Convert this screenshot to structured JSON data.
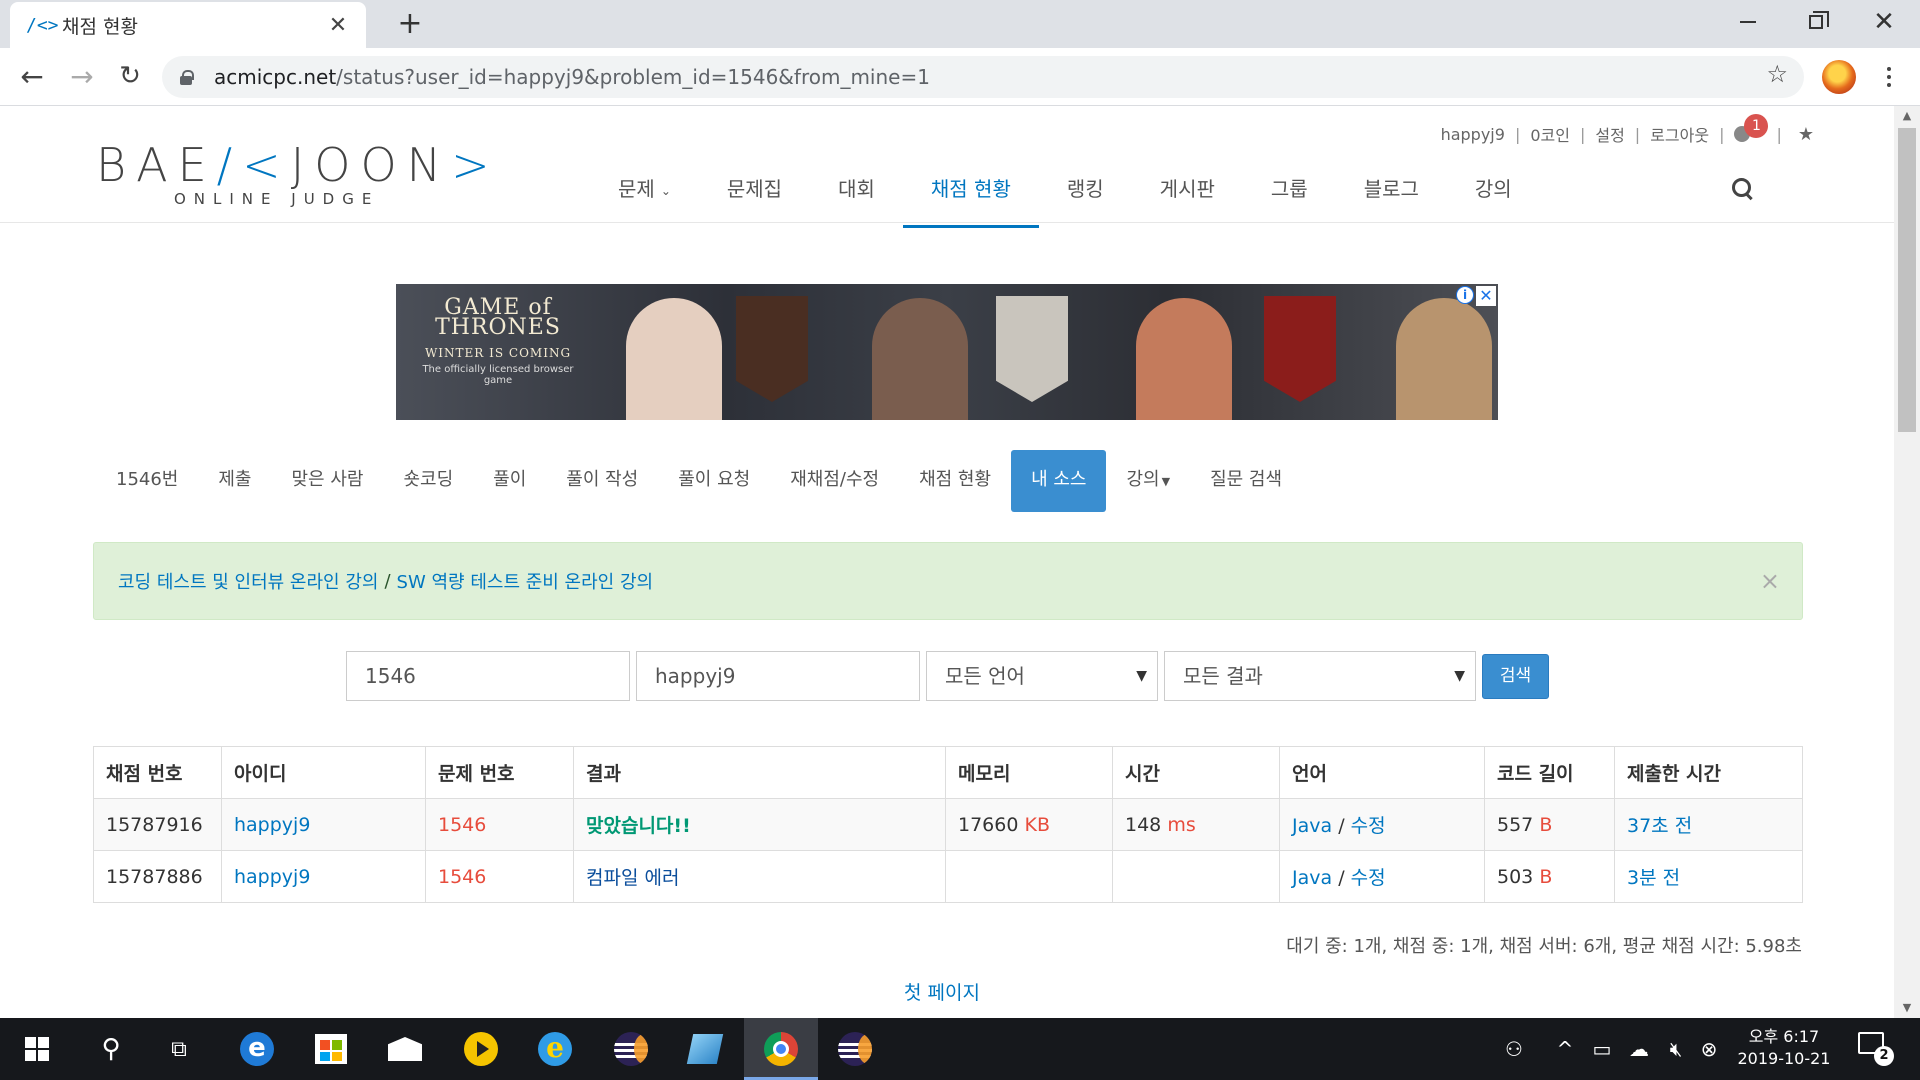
{
  "browser": {
    "tab_favicon": "/<>",
    "tab_title": "채점 현황",
    "tab_close": "✕",
    "new_tab": "+",
    "url_host": "acmicpc.net",
    "url_path": "/status?user_id=happyj9&problem_id=1546&from_mine=1"
  },
  "site": {
    "logo_left": "BAE",
    "logo_accent": "/<",
    "logo_right": "JOON",
    "logo_end": ">",
    "logo_sub": "ONLINE JUDGE",
    "toplinks": {
      "user": "happyj9",
      "coins": "0코인",
      "settings": "설정",
      "logout": "로그아웃",
      "notification_count": "1",
      "sep": "|",
      "favstar": "★"
    },
    "nav": [
      "문제",
      "문제집",
      "대회",
      "채점 현황",
      "랭킹",
      "게시판",
      "그룹",
      "블로그",
      "강의"
    ],
    "nav_active": "채점 현황"
  },
  "ad": {
    "title_1": "GAME of",
    "title_2": "THRONES",
    "subtitle": "WINTER IS COMING",
    "tagline": "The officially licensed browser game",
    "info": "i",
    "close": "✕"
  },
  "subnav": [
    "1546번",
    "제출",
    "맞은 사람",
    "숏코딩",
    "풀이",
    "풀이 작성",
    "풀이 요청",
    "재채점/수정",
    "채점 현황",
    "내 소스",
    "강의",
    "질문 검색"
  ],
  "alert": {
    "link1": "코딩 테스트 및 인터뷰 온라인 강의",
    "slash": "/",
    "link2": "SW 역량 테스트 준비 온라인 강의",
    "close": "×"
  },
  "search": {
    "problem_id": "1546",
    "user_id": "happyj9",
    "language": "모든 언어",
    "result": "모든 결과",
    "button": "검색",
    "dropdown_glyph": "▼"
  },
  "table": {
    "headers": [
      "채점 번호",
      "아이디",
      "문제 번호",
      "결과",
      "메모리",
      "시간",
      "언어",
      "코드 길이",
      "제출한 시간"
    ],
    "rows": [
      {
        "id": "15787916",
        "user": "happyj9",
        "problem": "1546",
        "result": "맞았습니다!!",
        "result_type": "accepted",
        "memory": "17660",
        "memory_unit": "KB",
        "time": "148",
        "time_unit": "ms",
        "language": "Java",
        "edit": "수정",
        "slash": "/",
        "length": "557",
        "length_unit": "B",
        "submitted": "37초 전"
      },
      {
        "id": "15787886",
        "user": "happyj9",
        "problem": "1546",
        "result": "컴파일 에러",
        "result_type": "compile_error",
        "memory": "",
        "memory_unit": "",
        "time": "",
        "time_unit": "",
        "language": "Java",
        "edit": "수정",
        "slash": "/",
        "length": "503",
        "length_unit": "B",
        "submitted": "3분 전"
      }
    ]
  },
  "summary": "대기 중: 1개, 채점 중: 1개, 채점 서버: 6개, 평균 채점 시간: 5.98초",
  "first_page": "첫 페이지",
  "taskbar": {
    "clock_period_time": "오후 6:17",
    "clock_date": "2019-10-21",
    "notification_count": "2",
    "icons": [
      "windows-start-icon",
      "search-icon",
      "task-view-icon",
      "edge-icon",
      "store-icon",
      "mail-icon",
      "media-player-icon",
      "internet-explorer-icon",
      "eclipse-icon",
      "notepad-icon",
      "chrome-icon",
      "eclipse-icon"
    ]
  },
  "colors": {
    "accent": "#0076c0",
    "active_tab": "#3a8ed0",
    "accepted": "#009874",
    "error_red": "#e74c3c",
    "alert_bg": "#dff0d8"
  }
}
